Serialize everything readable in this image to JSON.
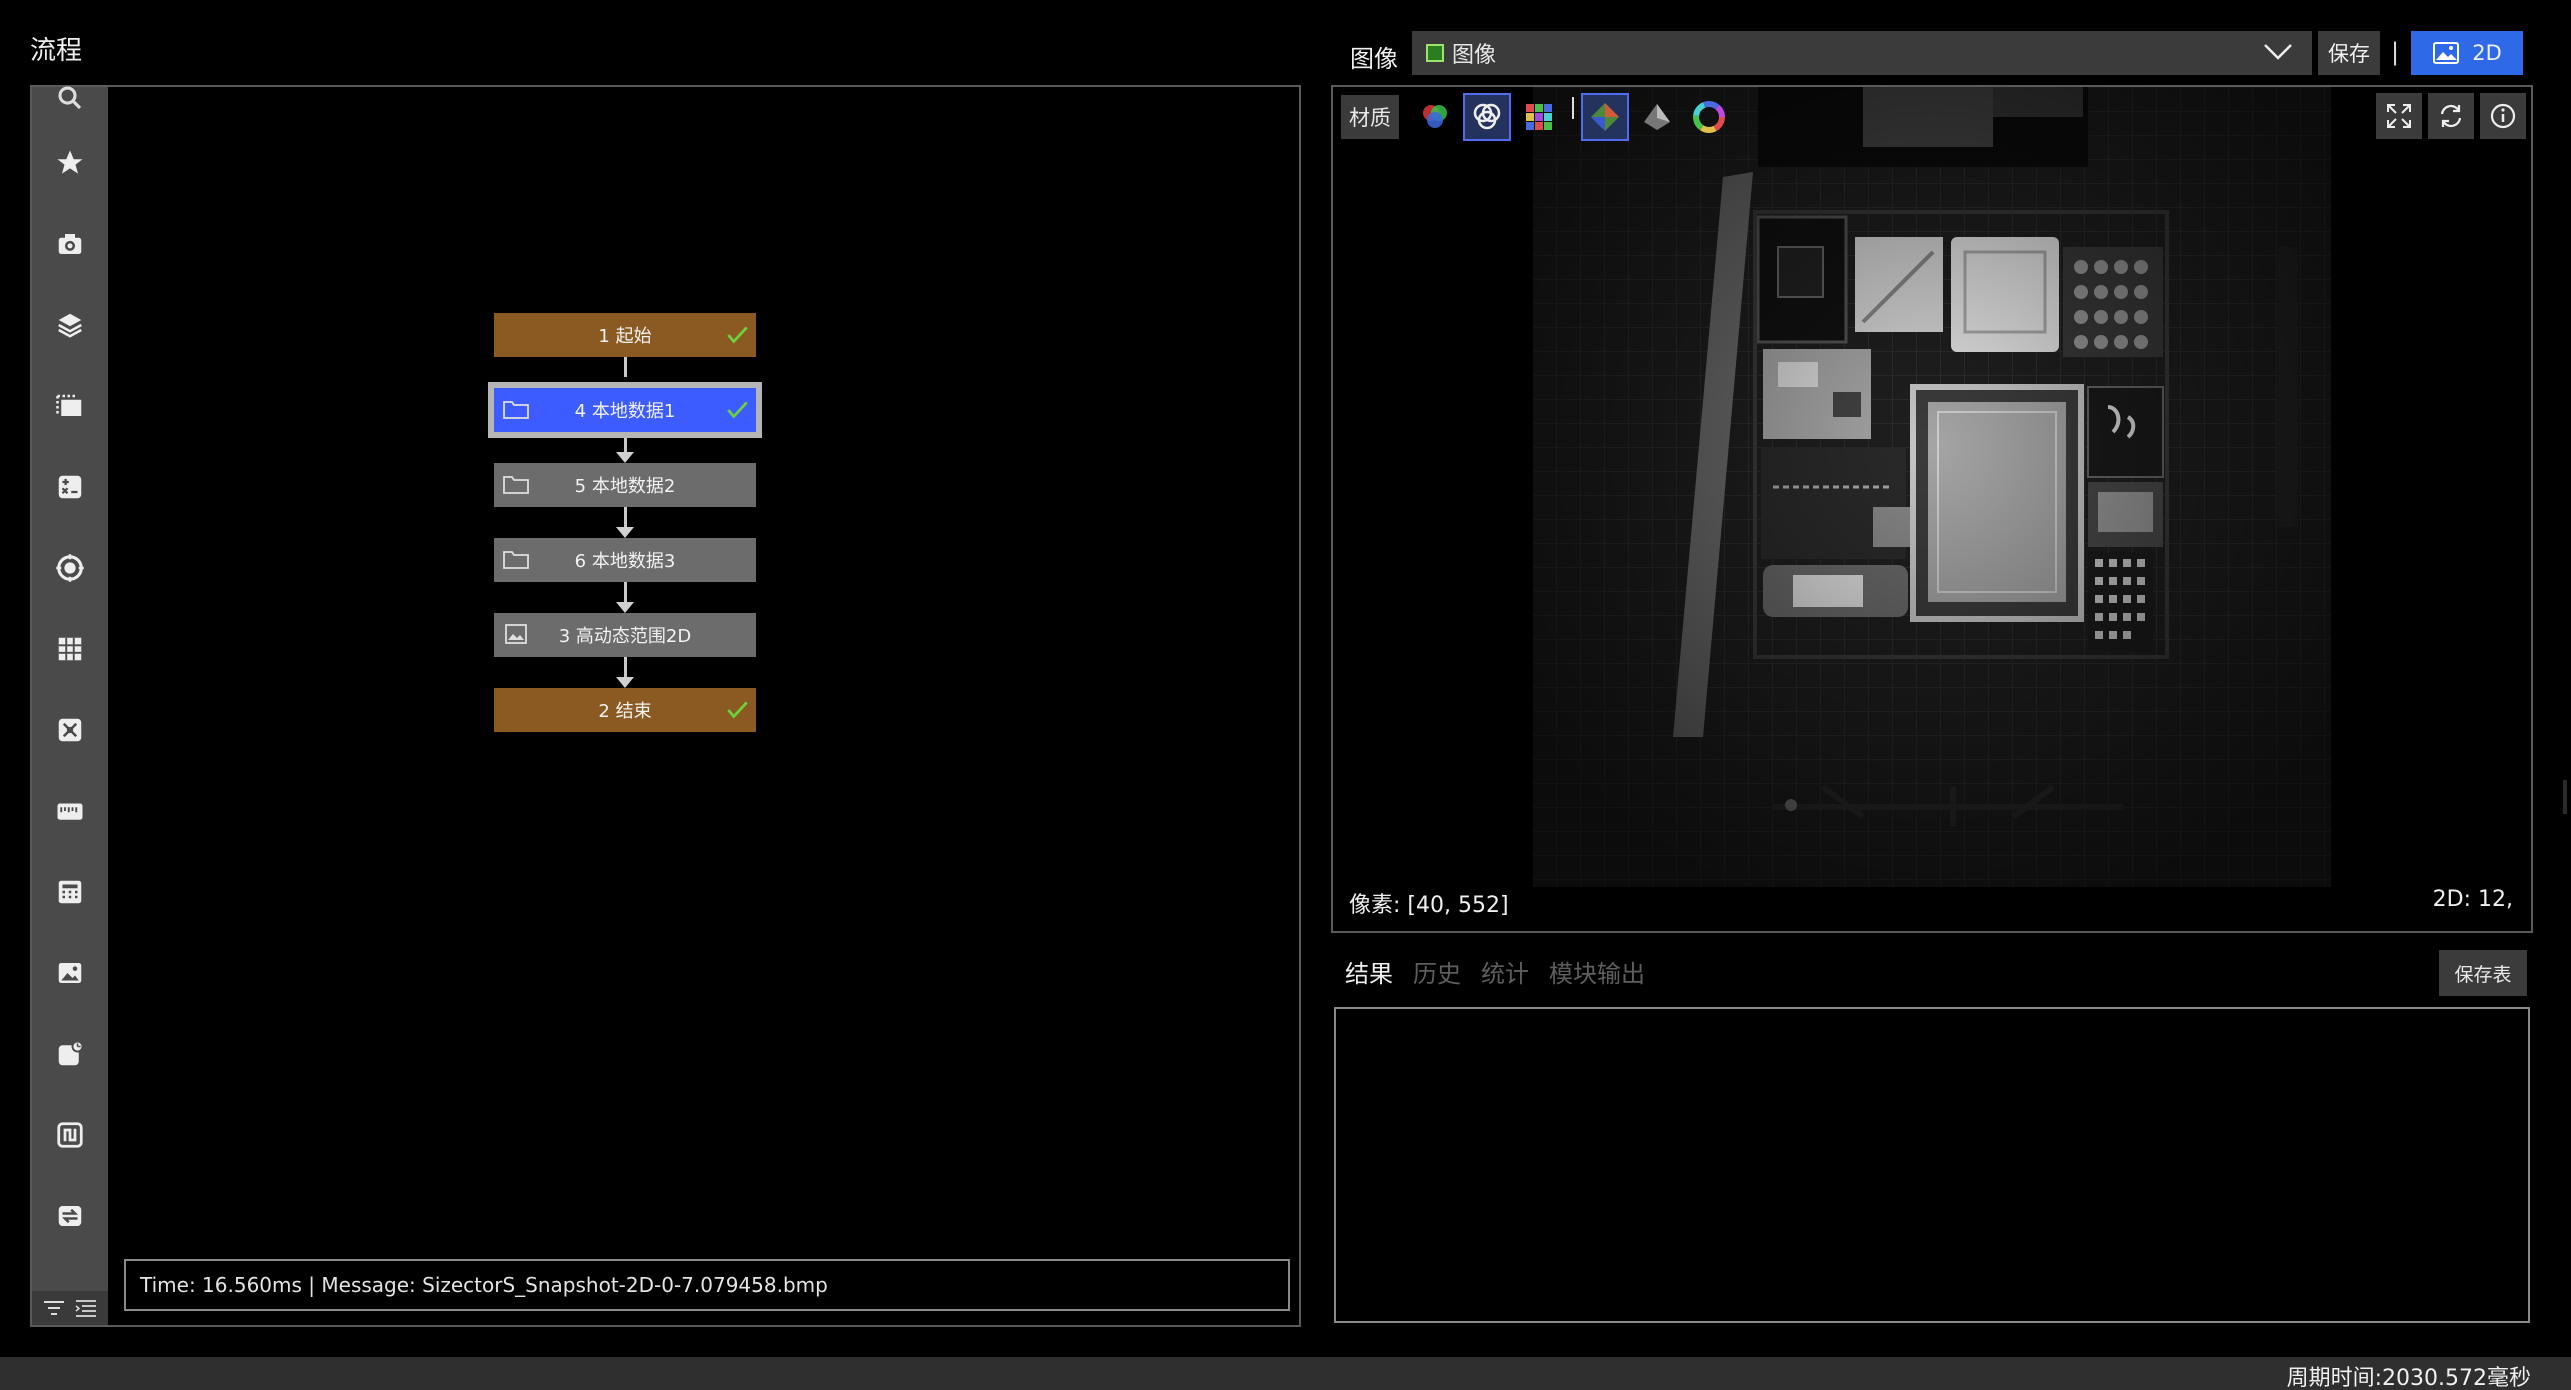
{
  "flow": {
    "title": "流程",
    "nodes": [
      {
        "label": "1 起始",
        "style": "special",
        "icon": "none",
        "status": "check-icon"
      },
      {
        "label": "4 本地数据1",
        "style": "selected",
        "icon": "folder-icon",
        "status": "check-icon"
      },
      {
        "label": "5 本地数据2",
        "style": "gray",
        "icon": "folder-icon",
        "status": "none"
      },
      {
        "label": "6 本地数据3",
        "style": "gray",
        "icon": "folder-icon",
        "status": "none"
      },
      {
        "label": "3 高动态范围2D",
        "style": "gray",
        "icon": "image-icon",
        "status": "none"
      },
      {
        "label": "2 结束",
        "style": "special",
        "icon": "none",
        "status": "check-icon"
      }
    ],
    "toolbox_icons": [
      "search-icon",
      "star-icon",
      "camera-icon",
      "layers-icon",
      "frames-icon",
      "image-math-icon",
      "target-icon",
      "grid-icon",
      "transform-icon",
      "ruler-icon",
      "calculator-icon",
      "picture-icon",
      "chart-icon",
      "loop-icon",
      "convert-icon"
    ],
    "message": "Time: 16.560ms |  Message: SizectorS_Snapshot-2D-0-7.079458.bmp"
  },
  "image": {
    "label": "图像",
    "selected_source": "图像",
    "save_label": "保存",
    "separator": "|",
    "mode_label": "2D",
    "material_label": "材质",
    "pixel_readout": "像素: [40, 552]",
    "value_readout": "2D: 12,"
  },
  "results": {
    "tabs": [
      "结果",
      "历史",
      "统计",
      "模块输出"
    ],
    "active_tab": 0,
    "save_table_label": "保存表"
  },
  "status": {
    "cycle_time": "周期时间:2030.572毫秒"
  },
  "colors": {
    "accent": "#2e6ae8",
    "node_special": "#8a5a22",
    "node_gray": "#6c6c6c",
    "node_selected": "#3d5cff",
    "check": "#6bd43c"
  }
}
